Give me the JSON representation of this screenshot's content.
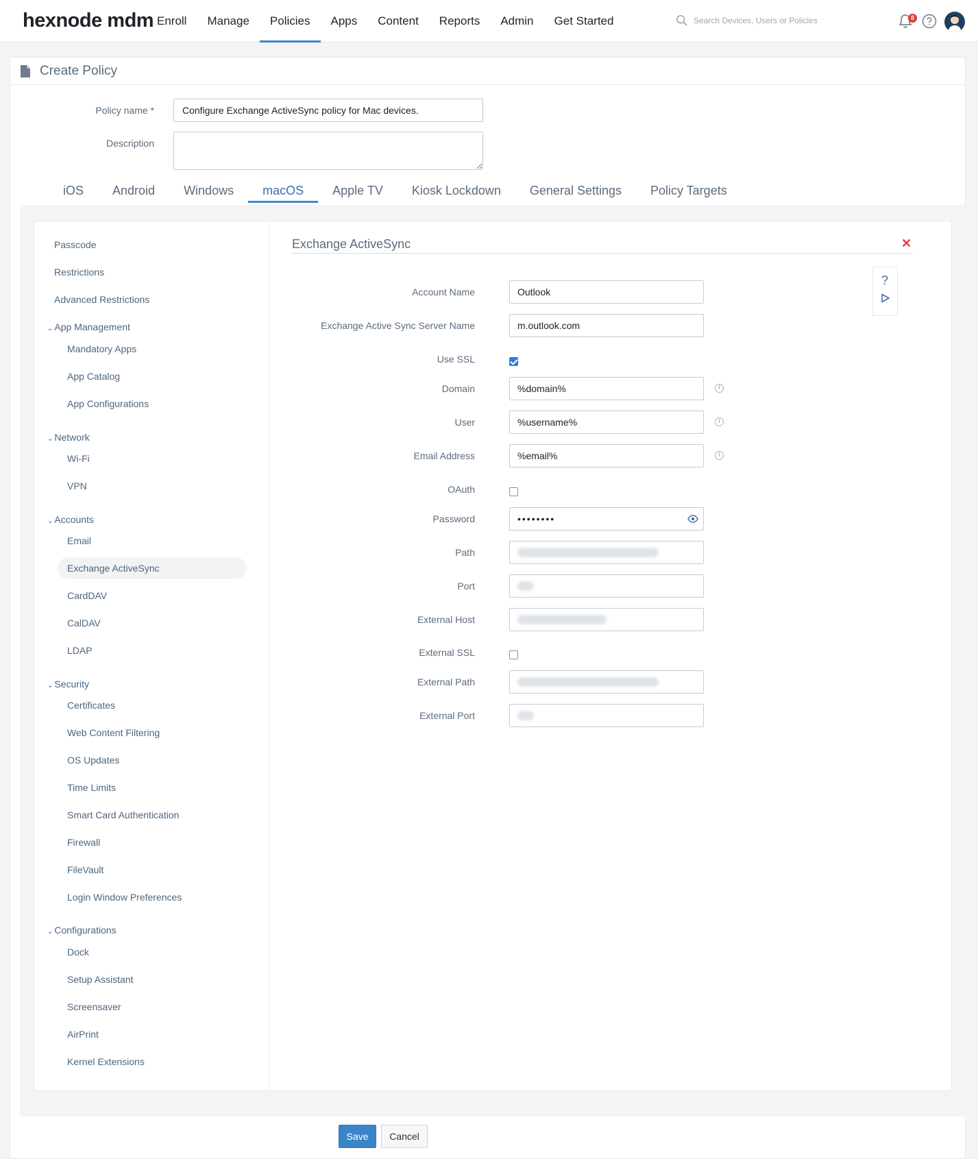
{
  "app": {
    "logo": "hexnode mdm"
  },
  "nav": [
    {
      "label": "Enroll"
    },
    {
      "label": "Manage"
    },
    {
      "label": "Policies",
      "active": true
    },
    {
      "label": "Apps"
    },
    {
      "label": "Content"
    },
    {
      "label": "Reports"
    },
    {
      "label": "Admin"
    },
    {
      "label": "Get Started"
    }
  ],
  "search": {
    "placeholder": "Search Devices, Users or Policies"
  },
  "notifications": {
    "count": "8"
  },
  "page": {
    "title": "Create Policy"
  },
  "form": {
    "policy_name_label": "Policy name *",
    "policy_name_value": "Configure Exchange ActiveSync policy for Mac devices.",
    "description_label": "Description",
    "description_value": ""
  },
  "tabs": [
    {
      "label": "iOS"
    },
    {
      "label": "Android"
    },
    {
      "label": "Windows"
    },
    {
      "label": "macOS",
      "active": true
    },
    {
      "label": "Apple TV"
    },
    {
      "label": "Kiosk Lockdown"
    },
    {
      "label": "General Settings"
    },
    {
      "label": "Policy Targets"
    }
  ],
  "sidebar": {
    "passcode": "Passcode",
    "restrictions": "Restrictions",
    "advanced_restrictions": "Advanced Restrictions",
    "app_management": "App Management",
    "mandatory_apps": "Mandatory Apps",
    "app_catalog": "App Catalog",
    "app_configurations": "App Configurations",
    "network": "Network",
    "wifi": "Wi-Fi",
    "vpn": "VPN",
    "accounts": "Accounts",
    "email": "Email",
    "exchange_activesync": "Exchange ActiveSync",
    "carddav": "CardDAV",
    "caldav": "CalDAV",
    "ldap": "LDAP",
    "security": "Security",
    "certificates": "Certificates",
    "web_content_filtering": "Web Content Filtering",
    "os_updates": "OS Updates",
    "time_limits": "Time Limits",
    "smart_card_authentication": "Smart Card Authentication",
    "firewall": "Firewall",
    "filevault": "FileVault",
    "login_window_preferences": "Login Window Preferences",
    "configurations": "Configurations",
    "dock": "Dock",
    "setup_assistant": "Setup Assistant",
    "screensaver": "Screensaver",
    "airprint": "AirPrint",
    "kernel_extensions": "Kernel Extensions"
  },
  "panel": {
    "title": "Exchange ActiveSync",
    "help_symbol": "?",
    "close_symbol": "✕",
    "fields": {
      "account_name": {
        "label": "Account Name",
        "value": "Outlook"
      },
      "server_name": {
        "label": "Exchange Active Sync Server Name",
        "value": "m.outlook.com"
      },
      "use_ssl": {
        "label": "Use SSL",
        "checked": true
      },
      "domain": {
        "label": "Domain",
        "value": "%domain%"
      },
      "user": {
        "label": "User",
        "value": "%username%"
      },
      "email_address": {
        "label": "Email Address",
        "value": "%email%"
      },
      "oauth": {
        "label": "OAuth",
        "checked": false
      },
      "password": {
        "label": "Password",
        "value": "••••••••"
      },
      "path": {
        "label": "Path"
      },
      "port": {
        "label": "Port"
      },
      "external_host": {
        "label": "External Host"
      },
      "external_ssl": {
        "label": "External SSL",
        "checked": false
      },
      "external_path": {
        "label": "External Path"
      },
      "external_port": {
        "label": "External Port"
      }
    }
  },
  "buttons": {
    "save": "Save",
    "cancel": "Cancel"
  },
  "colors": {
    "accent": "#3d87cf",
    "close": "#e53935",
    "save_button": "#3a85c9"
  }
}
